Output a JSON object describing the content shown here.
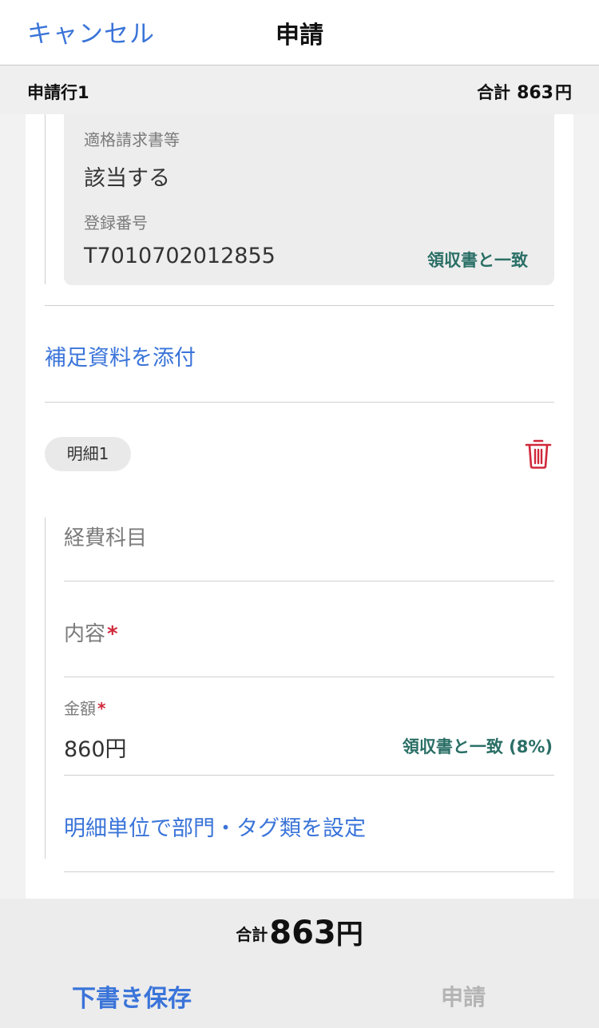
{
  "nav": {
    "cancel_label": "キャンセル",
    "title": "申請"
  },
  "section": {
    "title": "申請行1",
    "total_label": "合計",
    "total_amount": "863",
    "total_unit": "円"
  },
  "invoice": {
    "qualified_label": "適格請求書等",
    "qualified_value": "該当する",
    "reg_number_label": "登録番号",
    "reg_number_value": "T7010702012855",
    "reg_match": "領収書と一致"
  },
  "attach_link": "補足資料を添付",
  "detail": {
    "chip_label": "明細1",
    "account_label": "経費科目",
    "content_label": "内容",
    "required_mark": "*",
    "amount_label": "金額",
    "amount_value": "860",
    "amount_unit": "円",
    "amount_match": "領収書と一致 (8%)",
    "dept_tag_link": "明細単位で部門・タグ類を設定"
  },
  "footer": {
    "total_label": "合計",
    "total_amount": "863",
    "total_unit": "円",
    "draft_label": "下書き保存",
    "submit_label": "申請"
  },
  "colors": {
    "accent_blue": "#3a74d9",
    "match_green": "#2a6f66",
    "delete_red": "#d0283a",
    "disabled_gray": "#b4b4b4"
  },
  "icons": {
    "delete": "trash-icon"
  }
}
